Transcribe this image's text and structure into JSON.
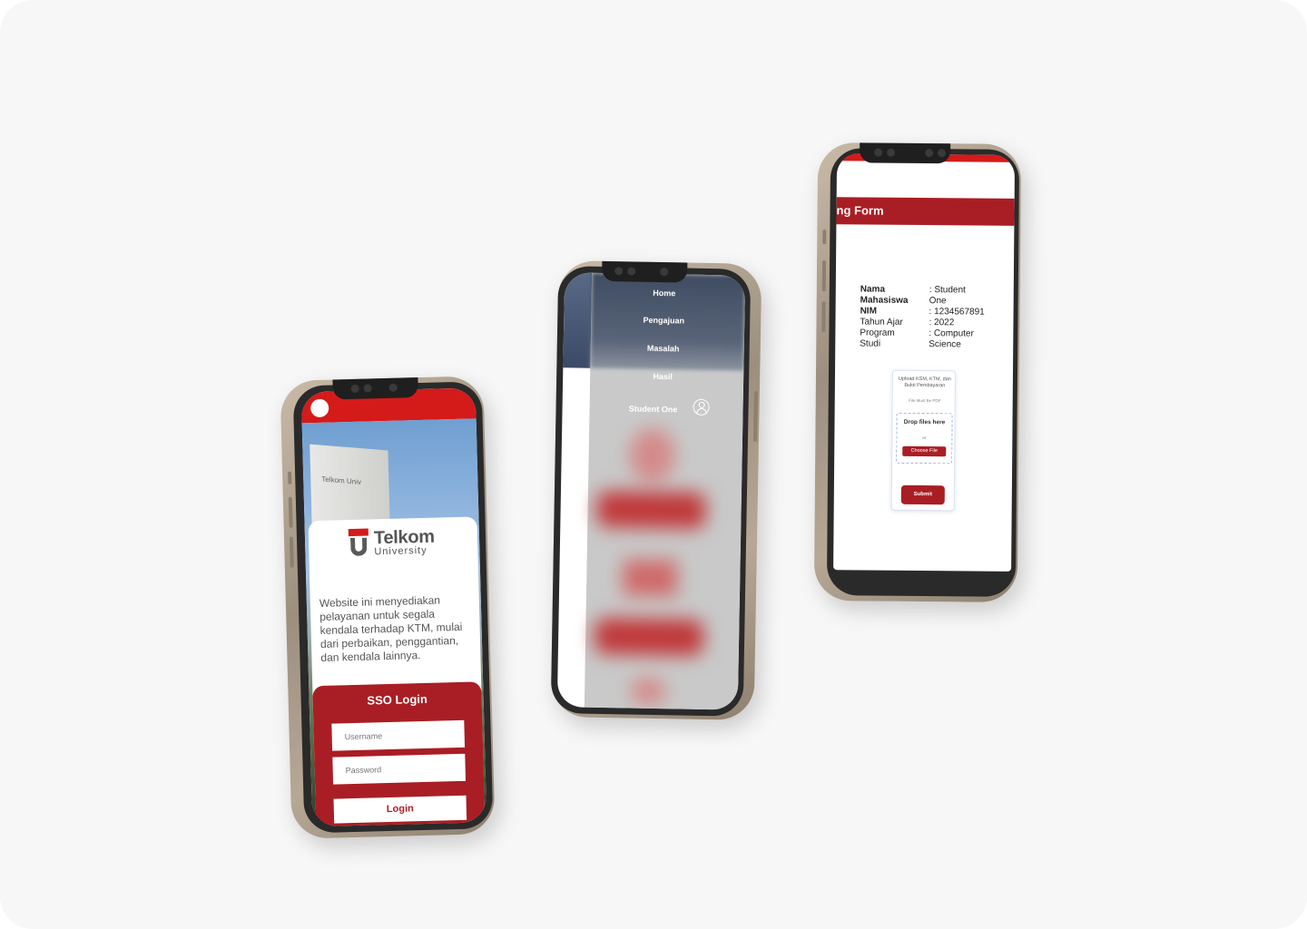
{
  "colors": {
    "brand_red": "#d51a1a",
    "dark_red": "#a91e24",
    "background": "#f7f7f7"
  },
  "login": {
    "brand_name": "Telkom",
    "brand_sub": "University",
    "building_sign": "Telkom Univ",
    "description": "Website ini menyediakan pelayanan untuk segala kendala terhadap KTM, mulai dari perbaikan, penggantian, dan kendala lainnya.",
    "sso_title": "SSO Login",
    "username_placeholder": "Username",
    "password_placeholder": "Password",
    "login_button": "Login"
  },
  "menu": {
    "items": [
      "Home",
      "Pengajuan",
      "Masalah",
      "Hasil"
    ],
    "user_name": "Student One",
    "user_icon": "user-circle-icon"
  },
  "form": {
    "header": "ng Form",
    "fields": [
      {
        "label": "Nama",
        "value": ": Student"
      },
      {
        "label": "Mahasiswa",
        "value": "One"
      },
      {
        "label": "NIM",
        "value": ": 1234567891"
      },
      {
        "label": "Tahun Ajar",
        "value": ": 2022"
      },
      {
        "label": "Program",
        "value": ": Computer"
      },
      {
        "label": "Studi",
        "value": "Science"
      }
    ],
    "upload_title": "Upload KSM, KTM, dan Bukti Pembayaran",
    "upload_note": "File Must Be PDF",
    "drop_text": "Drop files here",
    "or_text": "or",
    "choose_button": "Choose File",
    "submit_button": "Submit"
  }
}
